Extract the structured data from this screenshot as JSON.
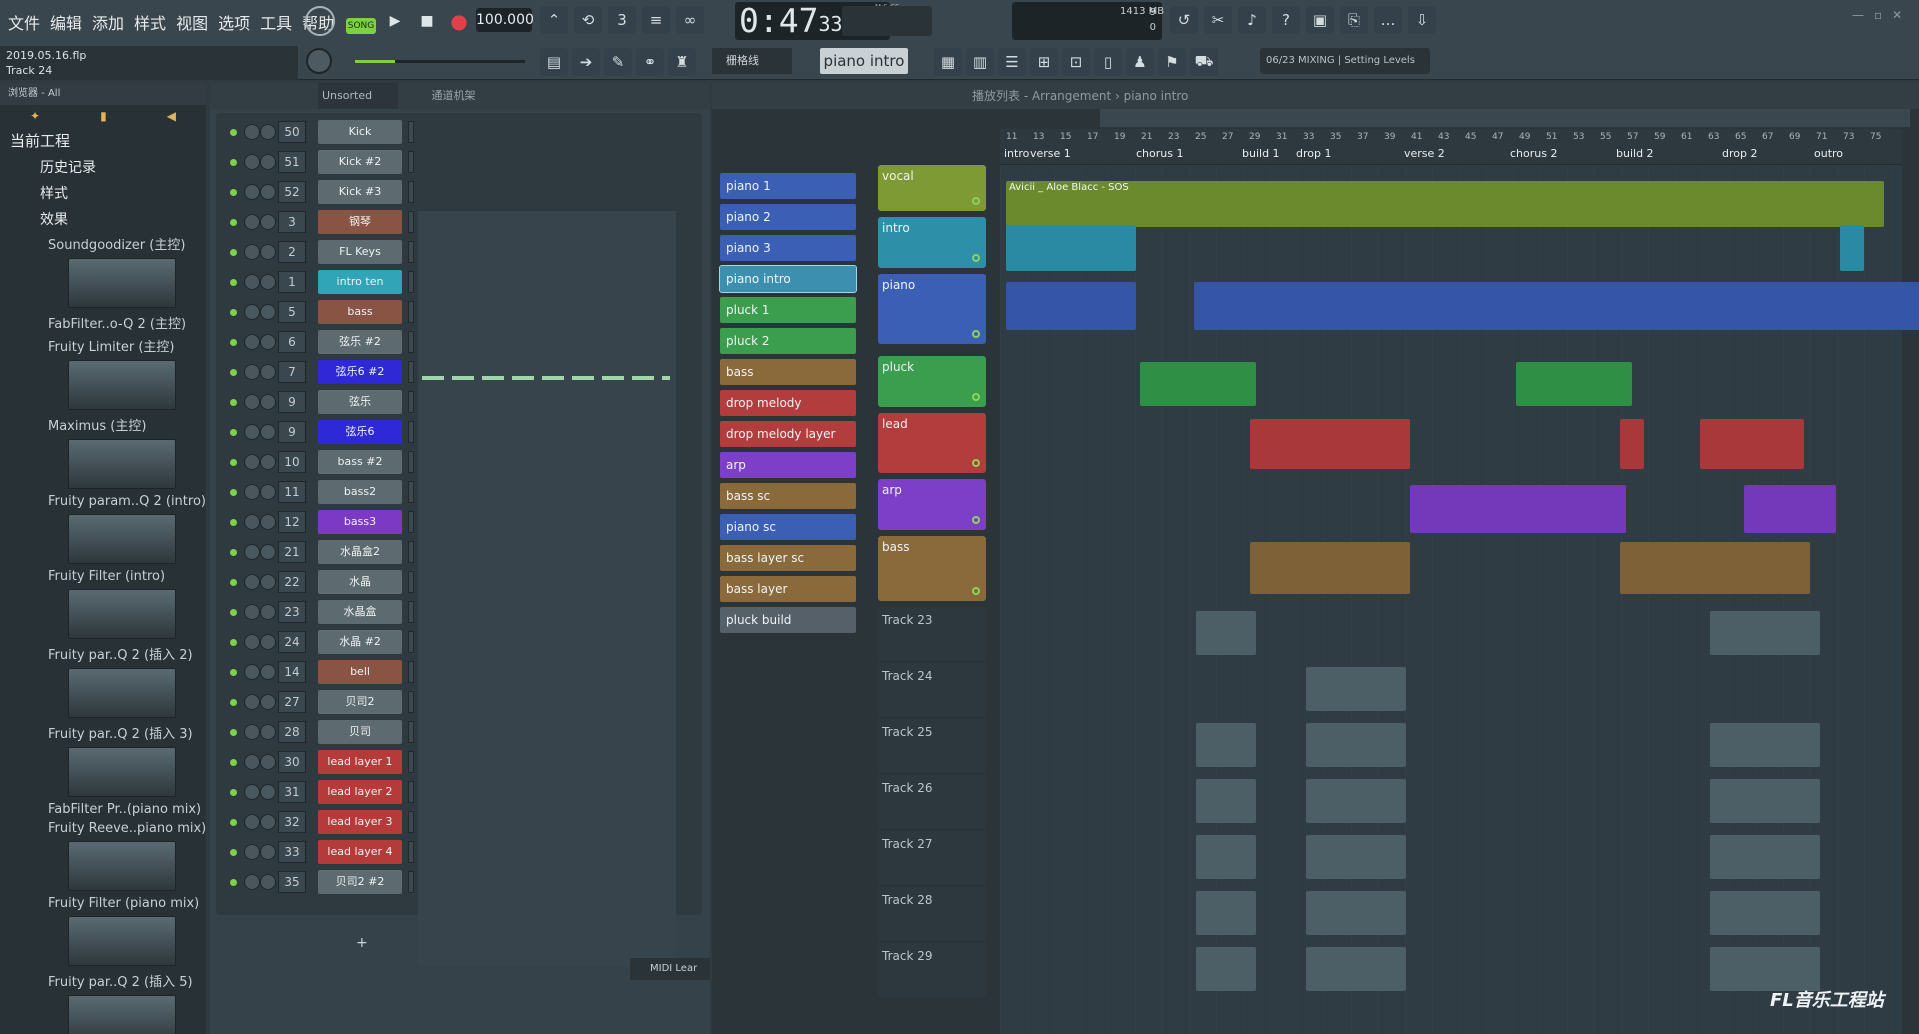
{
  "menu": [
    "文件",
    "编辑",
    "添加",
    "样式",
    "视图",
    "选项",
    "工具",
    "帮助"
  ],
  "mode": "SONG",
  "tempo": "100.000",
  "time": {
    "main": "0:47",
    "sub": "33",
    "unit": "M:S:CS"
  },
  "memory": {
    "top": "9",
    "mb": "1413 MB",
    "bottom": "0"
  },
  "project": {
    "name": "2019.05.16.flp",
    "track": "Track 24"
  },
  "snap": "栅格线",
  "pattern": "piano intro",
  "hint": "06/23 MIXING | Setting Levels",
  "browser": {
    "title": "浏览器 - All",
    "sections": [
      "当前工程",
      "历史记录",
      "样式",
      "效果"
    ],
    "effects": [
      "Soundgoodizer (主控)",
      "FabFilter..o-Q 2 (主控)",
      "Fruity Limiter (主控)",
      "Maximus (主控)",
      "Fruity param..Q 2 (intro)",
      "Fruity Filter (intro)",
      "Fruity par..Q 2 (插入 2)",
      "Fruity par..Q 2 (插入 3)",
      "FabFilter Pr..(piano mix)",
      "Fruity Reeve..piano mix)",
      "Fruity Filter (piano mix)",
      "Fruity par..Q 2 (插入 5)"
    ]
  },
  "rack": {
    "filter": "Unsorted",
    "title": "通道机架",
    "add": "+",
    "midi": "MIDI Lear",
    "channels": [
      {
        "n": "50",
        "name": "Kick",
        "c": ""
      },
      {
        "n": "51",
        "name": "Kick #2",
        "c": ""
      },
      {
        "n": "52",
        "name": "Kick #3",
        "c": ""
      },
      {
        "n": "3",
        "name": "钢琴",
        "c": "brown"
      },
      {
        "n": "2",
        "name": "FL Keys",
        "c": ""
      },
      {
        "n": "1",
        "name": "intro ten",
        "c": "sel"
      },
      {
        "n": "5",
        "name": "bass",
        "c": "brown"
      },
      {
        "n": "6",
        "name": "弦乐 #2",
        "c": ""
      },
      {
        "n": "7",
        "name": "弦乐6 #2",
        "c": "blue"
      },
      {
        "n": "9",
        "name": "弦乐",
        "c": ""
      },
      {
        "n": "9",
        "name": "弦乐6",
        "c": "blue"
      },
      {
        "n": "10",
        "name": "bass #2",
        "c": ""
      },
      {
        "n": "11",
        "name": "bass2",
        "c": ""
      },
      {
        "n": "12",
        "name": "bass3",
        "c": "purple"
      },
      {
        "n": "21",
        "name": "水晶盒2",
        "c": ""
      },
      {
        "n": "22",
        "name": "水晶",
        "c": ""
      },
      {
        "n": "23",
        "name": "水晶盒",
        "c": ""
      },
      {
        "n": "24",
        "name": "水晶 #2",
        "c": ""
      },
      {
        "n": "14",
        "name": "bell",
        "c": "brown"
      },
      {
        "n": "27",
        "name": "贝司2",
        "c": ""
      },
      {
        "n": "28",
        "name": "贝司",
        "c": ""
      },
      {
        "n": "30",
        "name": "lead layer 1",
        "c": "red"
      },
      {
        "n": "31",
        "name": "lead layer 2",
        "c": "red"
      },
      {
        "n": "32",
        "name": "lead layer 3",
        "c": "red"
      },
      {
        "n": "33",
        "name": "lead layer 4",
        "c": "red"
      },
      {
        "n": "35",
        "name": "贝司2 #2",
        "c": ""
      }
    ]
  },
  "playlist": {
    "title": "播放列表 - Arrangement",
    "crumb": "piano intro",
    "patterns": [
      {
        "name": "piano 1",
        "color": "#3a5fb5"
      },
      {
        "name": "piano 2",
        "color": "#3a5fb5"
      },
      {
        "name": "piano 3",
        "color": "#3a5fb5"
      },
      {
        "name": "piano intro",
        "color": "#3d8fb0"
      },
      {
        "name": "pluck 1",
        "color": "#3a9e4e"
      },
      {
        "name": "pluck 2",
        "color": "#3a9e4e"
      },
      {
        "name": "bass",
        "color": "#8a6a3a"
      },
      {
        "name": "drop melody",
        "color": "#b33c3c"
      },
      {
        "name": "drop melody layer",
        "color": "#b33c3c"
      },
      {
        "name": "arp",
        "color": "#7d3fc7"
      },
      {
        "name": "bass sc",
        "color": "#8a6a3a"
      },
      {
        "name": "piano sc",
        "color": "#3a5fb5"
      },
      {
        "name": "bass layer sc",
        "color": "#8a6a3a"
      },
      {
        "name": "bass layer",
        "color": "#8a6a3a"
      },
      {
        "name": "pluck build",
        "color": "#556069"
      }
    ],
    "tracks": [
      {
        "name": "vocal",
        "color": "#7e9a35",
        "h": 46
      },
      {
        "name": "intro",
        "color": "#2e8fa8",
        "h": 51
      },
      {
        "name": "piano",
        "color": "#3a5fb5",
        "h": 70
      },
      {
        "name": "pluck",
        "color": "#3a9e4e",
        "h": 51
      },
      {
        "name": "lead",
        "color": "#b33c3c",
        "h": 60
      },
      {
        "name": "arp",
        "color": "#7d3fc7",
        "h": 51
      },
      {
        "name": "bass",
        "color": "#8a6a3a",
        "h": 65
      }
    ],
    "plain_tracks": [
      "Track 23",
      "Track 24",
      "Track 25",
      "Track 26",
      "Track 27",
      "Track 28",
      "Track 29"
    ],
    "bars": [
      "11",
      "13",
      "15",
      "17",
      "19",
      "21",
      "23",
      "25",
      "27",
      "29",
      "31",
      "33",
      "35",
      "37",
      "39",
      "41",
      "43",
      "45",
      "47",
      "49",
      "51",
      "53",
      "55",
      "57",
      "59",
      "61",
      "63",
      "65",
      "67",
      "69",
      "71",
      "73",
      "75"
    ],
    "markers": [
      "intro",
      "verse 1",
      "chorus 1",
      "build 1",
      "drop 1",
      "verse 2",
      "chorus 2",
      "build 2",
      "drop 2",
      "outro"
    ],
    "vocal_clip": "Avicii _ Aloe Blacc - SOS"
  },
  "watermark": "FL音乐工程站"
}
